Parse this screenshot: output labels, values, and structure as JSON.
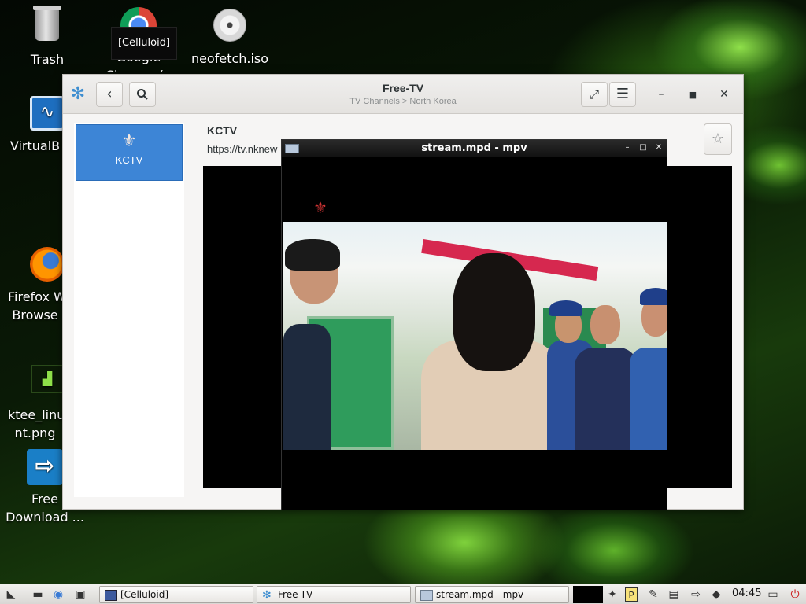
{
  "desktop": {
    "icons": [
      {
        "label": "Trash",
        "icon": "trash-icon"
      },
      {
        "label": "Google\nChrome (u",
        "icon": "chrome-icon"
      },
      {
        "label": "neofetch.iso",
        "icon": "disc-icon"
      },
      {
        "label": "VirtualB",
        "icon": "virtualbox-icon"
      },
      {
        "label": "Firefox W\nBrowse",
        "icon": "firefox-icon"
      },
      {
        "label": "ktee_linu\nnt.png",
        "icon": "image-file-icon"
      },
      {
        "label": "Free\nDownload ...",
        "icon": "fdm-icon"
      }
    ],
    "tooltip": "[Celluloid]"
  },
  "freetv": {
    "title": "Free-TV",
    "subtitle": "TV Channels > North Korea",
    "channel_name": "KCTV",
    "channel_title": "KCTV",
    "channel_url": "https://tv.nknew",
    "star_glyph": "☆"
  },
  "mpv": {
    "title": "stream.mpd - mpv"
  },
  "taskbar": {
    "tasks": [
      {
        "label": "[Celluloid]"
      },
      {
        "label": "Free-TV"
      },
      {
        "label": "stream.mpd - mpv"
      }
    ],
    "clock": "04:45"
  },
  "colors": {
    "accent": "#3d85d6",
    "desktop_green": "#7fd23c"
  }
}
